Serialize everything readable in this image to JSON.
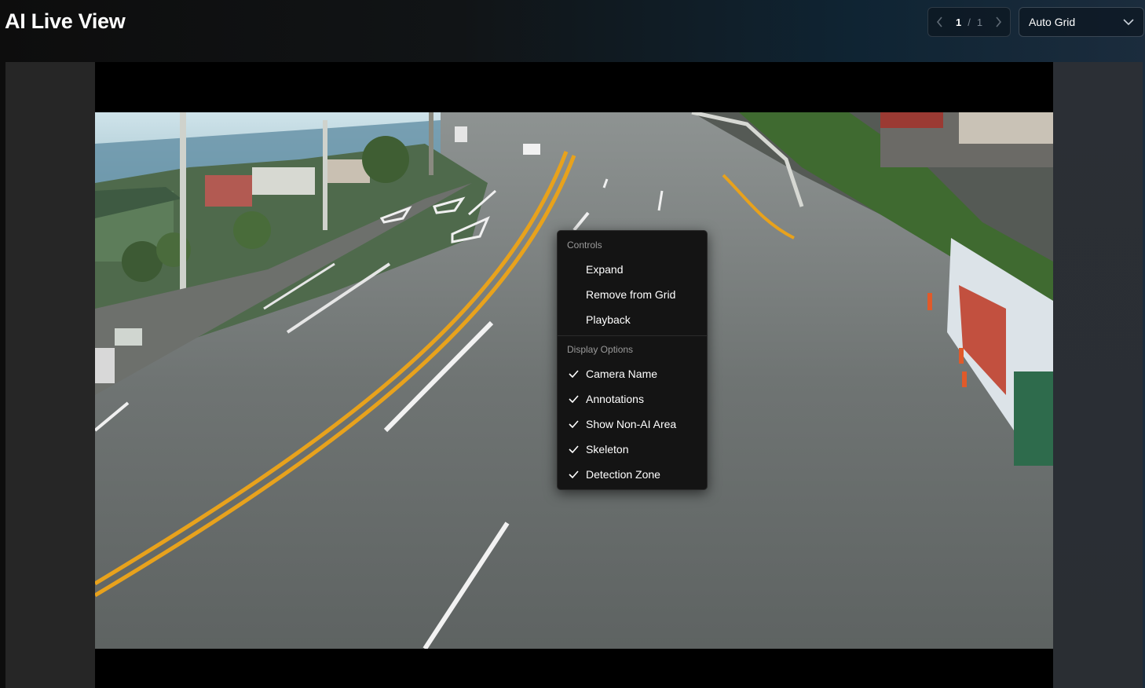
{
  "header": {
    "title": "AI Live View",
    "pagination": {
      "current": "1",
      "separator": "/",
      "total": "1"
    },
    "grid_mode": {
      "selected": "Auto Grid"
    }
  },
  "context_menu": {
    "controls_header": "Controls",
    "controls": [
      {
        "label": "Expand"
      },
      {
        "label": "Remove from Grid"
      },
      {
        "label": "Playback"
      }
    ],
    "display_header": "Display Options",
    "display_options": [
      {
        "label": "Camera Name",
        "checked": true
      },
      {
        "label": "Annotations",
        "checked": true
      },
      {
        "label": "Show Non-AI Area",
        "checked": true
      },
      {
        "label": "Skeleton",
        "checked": true
      },
      {
        "label": "Detection Zone",
        "checked": true
      }
    ]
  },
  "colors": {
    "accent_text": "#ffffff",
    "menu_bg": "#141414",
    "road_line_yellow": "#e8a21c"
  }
}
